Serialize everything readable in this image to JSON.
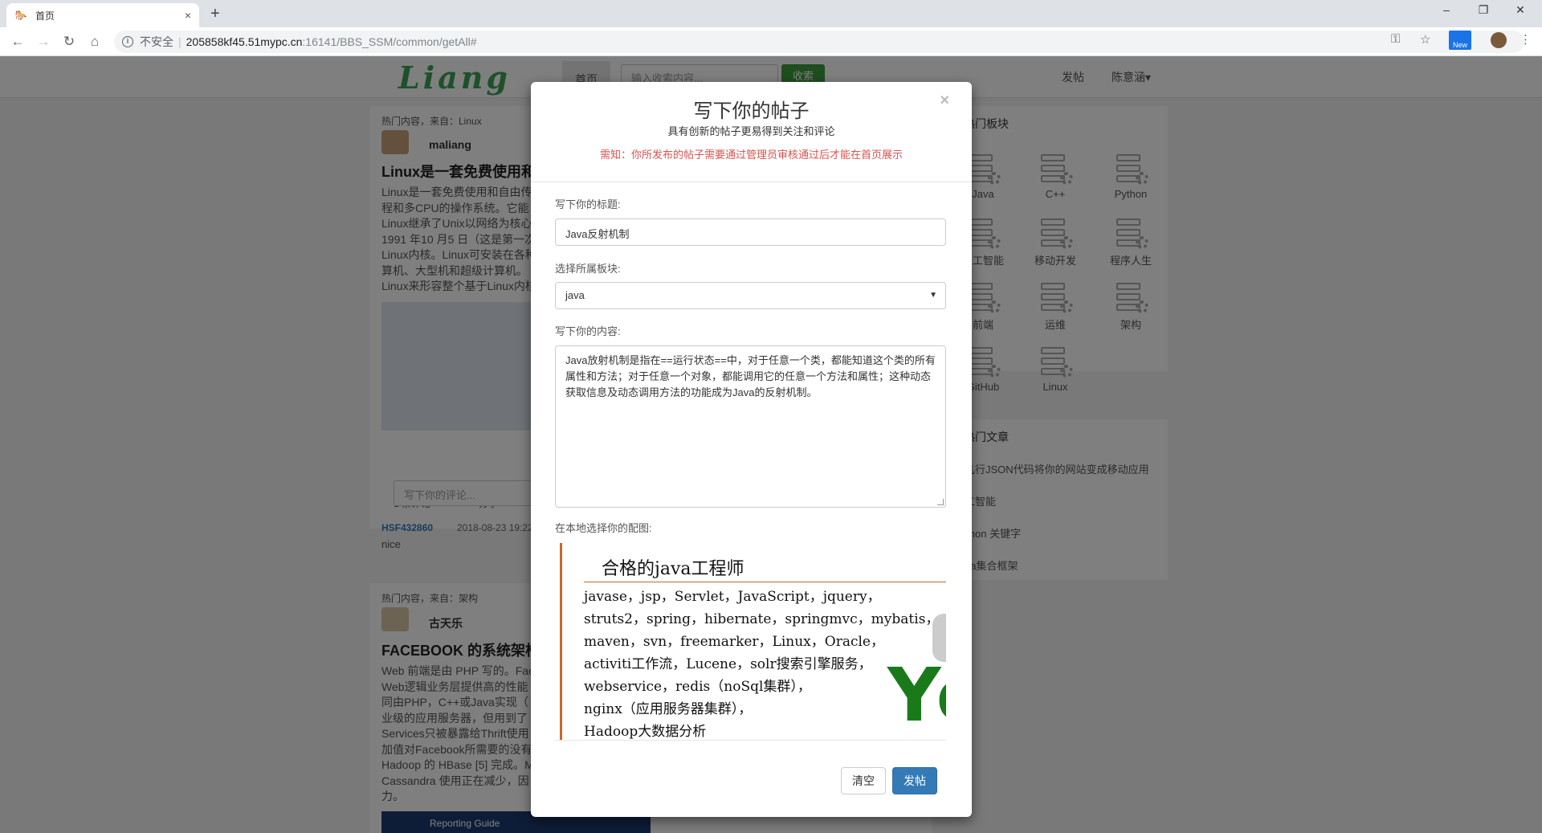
{
  "browser": {
    "tab_title": "首页",
    "tab_close": "×",
    "new_tab": "+",
    "win_min": "–",
    "win_restore": "❐",
    "win_close": "✕",
    "address": {
      "security_label": "不安全",
      "separator": "|",
      "host": "205858kf45.51mypc.cn",
      "path": ":16141/BBS_SSM/common/getAll#"
    },
    "ext_badge": "New"
  },
  "site": {
    "logo": "Liang",
    "nav_home": "首页",
    "search_placeholder": "输入收索内容...",
    "collect_label": "收索",
    "post_label": "发帖",
    "user_label": "陈意涵▾"
  },
  "feed": {
    "post1": {
      "source": "热门内容，来自：Linux",
      "author": "maliang",
      "title": "Linux是一套免费使用和",
      "lines": [
        "Linux是一套免费使用和自由传",
        "程和多CPU的操作系统。它能",
        "Linux继承了Unix以网络为核心",
        "1991 年10 月5 日（这是第一次",
        "Linux内核。Linux可安装在各种",
        "算机、大型机和超级计算机。",
        "Linux来形容整个基于Linux内核"
      ],
      "comments": "1 条评论",
      "share": "分享",
      "comment_placeholder": "写下你的评论...",
      "comment_user": "HSF432860",
      "comment_time": "2018-08-23 19:22",
      "comment_text": "nice"
    },
    "post2": {
      "source": "热门内容，来自：架构",
      "author": "古天乐",
      "title": "FACEBOOK 的系统架构",
      "lines": [
        "Web 前端是由 PHP 写的。Fac",
        "Web逻辑业务层提供高的性能",
        "同由PHP，C++或Java实现（",
        "业级的应用服务器，但用到了",
        "Services只被暴露给Thrift使用",
        "加值对Facebook所需要的没有",
        "Hadoop 的 HBase [5] 完成。M",
        "Cassandra 使用正在减少，因",
        "力。"
      ],
      "banner": "Reporting Guide"
    }
  },
  "sidebar": {
    "boards_title": "热门板块",
    "boards": [
      "Java",
      "C++",
      "Python",
      "人工智能",
      "移动开发",
      "程序人生",
      "前端",
      "运维",
      "架构",
      "GitHub",
      "Linux"
    ],
    "hot_title": "热门文章",
    "hot": [
      "用几行JSON代码将你的网站变成移动应用",
      "人工智能",
      "Python 关键字",
      "Java集合框架"
    ]
  },
  "modal": {
    "title": "写下你的帖子",
    "subtitle": "具有创新的帖子更易得到关注和评论",
    "notice": "需知：你所发布的帖子需要通过管理员审核通过后才能在首页展示",
    "close": "×",
    "title_label": "写下你的标题:",
    "title_value": "Java反射机制",
    "board_label": "选择所属板块:",
    "board_value": "java",
    "content_label": "写下你的内容:",
    "content_value": "Java放射机制是指在==运行状态==中，对于任意一个类，都能知道这个类的所有属性和方法；对于任意一个对象，都能调用它的任意一个方法和属性；这种动态获取信息及动态调用方法的功能成为Java的反射机制。",
    "image_label": "在本地选择你的配图:",
    "image": {
      "heading": "合格的java工程师",
      "lines": [
        "javase，jsp，Servlet，JavaScript，jquery，",
        "struts2，spring，hibernate，springmvc，mybatis，",
        "maven，svn，freemarker，Linux，Oracle，",
        "activiti工作流，Lucene，solr搜索引擎服务，",
        "webservice，redis（noSql集群），",
        "nginx（应用服务器集群），",
        "Hadoop大数据分析"
      ],
      "logo_text": "Yc"
    },
    "clear_label": "清空",
    "submit_label": "发帖"
  }
}
